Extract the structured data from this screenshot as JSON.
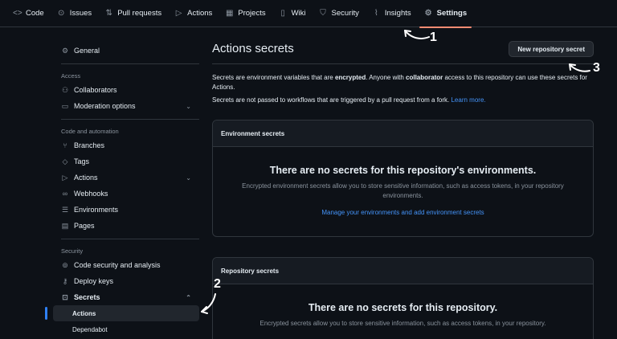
{
  "nav": {
    "tabs": [
      {
        "icon": "code-icon",
        "glyph": "<>",
        "label": "Code"
      },
      {
        "icon": "issues-icon",
        "glyph": "⊙",
        "label": "Issues"
      },
      {
        "icon": "pull-request-icon",
        "glyph": "⇅",
        "label": "Pull requests"
      },
      {
        "icon": "actions-icon",
        "glyph": "▷",
        "label": "Actions"
      },
      {
        "icon": "projects-icon",
        "glyph": "▦",
        "label": "Projects"
      },
      {
        "icon": "wiki-icon",
        "glyph": "▯",
        "label": "Wiki"
      },
      {
        "icon": "security-icon",
        "glyph": "⛉",
        "label": "Security"
      },
      {
        "icon": "insights-icon",
        "glyph": "⌇",
        "label": "Insights"
      },
      {
        "icon": "gear-icon",
        "glyph": "⚙",
        "label": "Settings"
      }
    ]
  },
  "sidebar": {
    "general": "General",
    "access_heading": "Access",
    "collaborators": "Collaborators",
    "moderation": "Moderation options",
    "code_heading": "Code and automation",
    "branches": "Branches",
    "tags": "Tags",
    "actions": "Actions",
    "webhooks": "Webhooks",
    "environments": "Environments",
    "pages": "Pages",
    "security_heading": "Security",
    "code_security": "Code security and analysis",
    "deploy_keys": "Deploy keys",
    "secrets": "Secrets",
    "secrets_actions": "Actions",
    "secrets_dependabot": "Dependabot"
  },
  "main": {
    "title": "Actions secrets",
    "new_button": "New repository secret",
    "desc_a": "Secrets are environment variables that are ",
    "desc_b": "encrypted",
    "desc_c": ". Anyone with ",
    "desc_d": "collaborator",
    "desc_e": " access to this repository can use these secrets for Actions.",
    "desc2": "Secrets are not passed to workflows that are triggered by a pull request from a fork. ",
    "learn_more": "Learn more.",
    "env": {
      "header": "Environment secrets",
      "heading": "There are no secrets for this repository's environments.",
      "text": "Encrypted environment secrets allow you to store sensitive information, such as access tokens, in your repository environments.",
      "link": "Manage your environments and add environment secrets"
    },
    "repo": {
      "header": "Repository secrets",
      "heading": "There are no secrets for this repository.",
      "text": "Encrypted secrets allow you to store sensitive information, such as access tokens, in your repository."
    }
  },
  "annotations": [
    "1",
    "2",
    "3"
  ]
}
